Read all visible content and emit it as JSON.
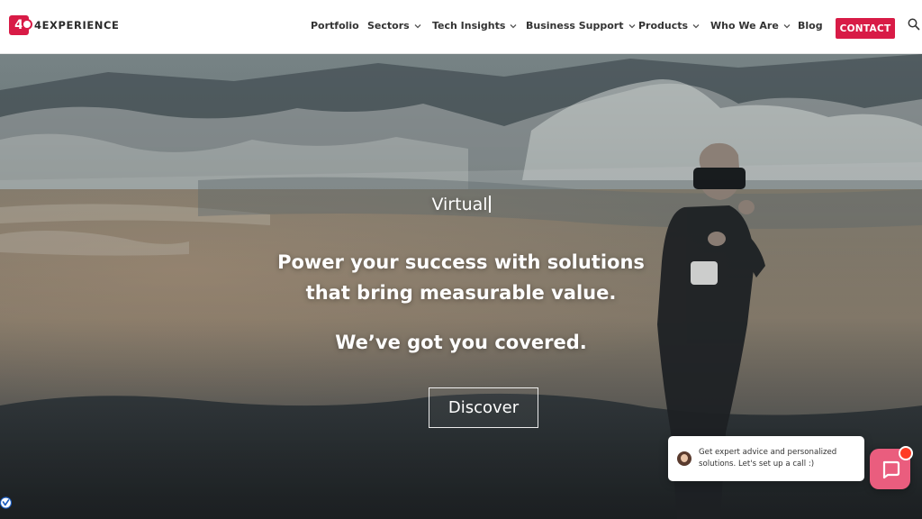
{
  "brand": {
    "name": "4EXPERIENCE",
    "mark": "4",
    "color": "#d81b46"
  },
  "nav": {
    "items": [
      {
        "label": "Portfolio",
        "dropdown": false
      },
      {
        "label": "Sectors",
        "dropdown": true
      },
      {
        "label": "Tech Insights",
        "dropdown": true
      },
      {
        "label": "Business Support",
        "dropdown": true
      },
      {
        "label": "Products",
        "dropdown": true
      },
      {
        "label": "Who We Are",
        "dropdown": true
      },
      {
        "label": "Blog",
        "dropdown": false
      }
    ],
    "contact_label": "CONTACT",
    "search_icon": "search-icon"
  },
  "hero": {
    "typed_text": "Virtual",
    "tagline_line1": "Power your success with solutions",
    "tagline_line2": "that bring measurable value.",
    "tagline3": "We’ve got you covered.",
    "cta_label": "Discover"
  },
  "chat": {
    "message": "Get expert advice and personalized solutions. Let's set up a call :)",
    "launcher_color": "#ea5d7e",
    "icon": "chat-icon"
  }
}
